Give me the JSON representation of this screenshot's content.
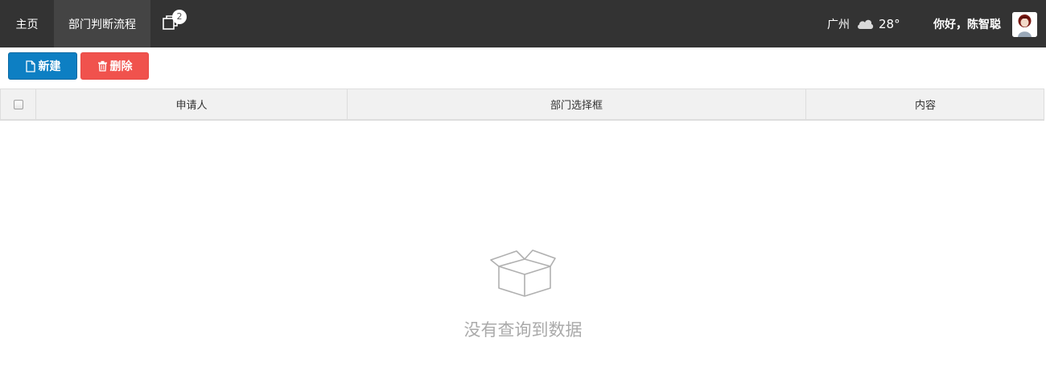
{
  "header": {
    "nav_home": "主页",
    "nav_active_tab": "部门判断流程",
    "window_icon": "windows-icon",
    "window_badge": "2",
    "weather_city": "广州",
    "weather_icon": "cloud-icon",
    "weather_temp": "28°",
    "greeting": "你好，陈智聪",
    "avatar_icon": "user-avatar"
  },
  "toolbar": {
    "new_label": "新建",
    "new_icon": "file-icon",
    "delete_label": "删除",
    "delete_icon": "trash-icon"
  },
  "table": {
    "columns": [
      "申请人",
      "部门选择框",
      "内容"
    ],
    "rows": []
  },
  "empty_state": {
    "icon": "empty-box-icon",
    "text": "没有查询到数据"
  },
  "colors": {
    "topbar_bg": "#333333",
    "active_tab_bg": "#444444",
    "new_button": "#0d7fc3",
    "delete_button": "#f0524d",
    "header_row_bg": "#f1f1f1",
    "empty_text": "#aaaaaa"
  }
}
